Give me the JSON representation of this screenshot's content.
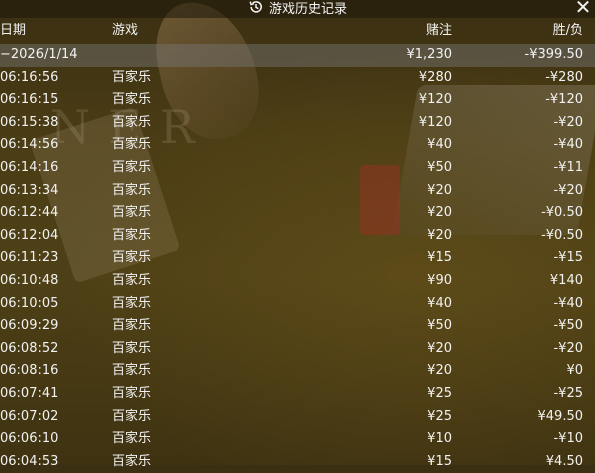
{
  "window": {
    "title": "游戏历史记录",
    "title_icon": "history-icon",
    "close_label": "✕"
  },
  "table": {
    "columns": {
      "date": "日期",
      "game": "游戏",
      "bet": "赌注",
      "pl": "胜/负"
    },
    "summary": {
      "date": "−2026/1/14",
      "game": "",
      "bet": "¥1,230",
      "pl": "-¥399.50"
    },
    "rows": [
      {
        "time": "06:16:56",
        "game": "百家乐",
        "bet": "¥280",
        "pl": "-¥280"
      },
      {
        "time": "06:16:15",
        "game": "百家乐",
        "bet": "¥120",
        "pl": "-¥120"
      },
      {
        "time": "06:15:38",
        "game": "百家乐",
        "bet": "¥120",
        "pl": "-¥20"
      },
      {
        "time": "06:14:56",
        "game": "百家乐",
        "bet": "¥40",
        "pl": "-¥40"
      },
      {
        "time": "06:14:16",
        "game": "百家乐",
        "bet": "¥50",
        "pl": "-¥11"
      },
      {
        "time": "06:13:34",
        "game": "百家乐",
        "bet": "¥20",
        "pl": "-¥20"
      },
      {
        "time": "06:12:44",
        "game": "百家乐",
        "bet": "¥20",
        "pl": "-¥0.50"
      },
      {
        "time": "06:12:04",
        "game": "百家乐",
        "bet": "¥20",
        "pl": "-¥0.50"
      },
      {
        "time": "06:11:23",
        "game": "百家乐",
        "bet": "¥15",
        "pl": "-¥15"
      },
      {
        "time": "06:10:48",
        "game": "百家乐",
        "bet": "¥90",
        "pl": "¥140"
      },
      {
        "time": "06:10:05",
        "game": "百家乐",
        "bet": "¥40",
        "pl": "-¥40"
      },
      {
        "time": "06:09:29",
        "game": "百家乐",
        "bet": "¥50",
        "pl": "-¥50"
      },
      {
        "time": "06:08:52",
        "game": "百家乐",
        "bet": "¥20",
        "pl": "-¥20"
      },
      {
        "time": "06:08:16",
        "game": "百家乐",
        "bet": "¥20",
        "pl": "¥0"
      },
      {
        "time": "06:07:41",
        "game": "百家乐",
        "bet": "¥25",
        "pl": "-¥25"
      },
      {
        "time": "06:07:02",
        "game": "百家乐",
        "bet": "¥25",
        "pl": "¥49.50"
      },
      {
        "time": "06:06:10",
        "game": "百家乐",
        "bet": "¥10",
        "pl": "-¥10"
      },
      {
        "time": "06:04:53",
        "game": "百家乐",
        "bet": "¥15",
        "pl": "¥4.50"
      }
    ]
  },
  "background": {
    "watermark_text": "NER"
  }
}
